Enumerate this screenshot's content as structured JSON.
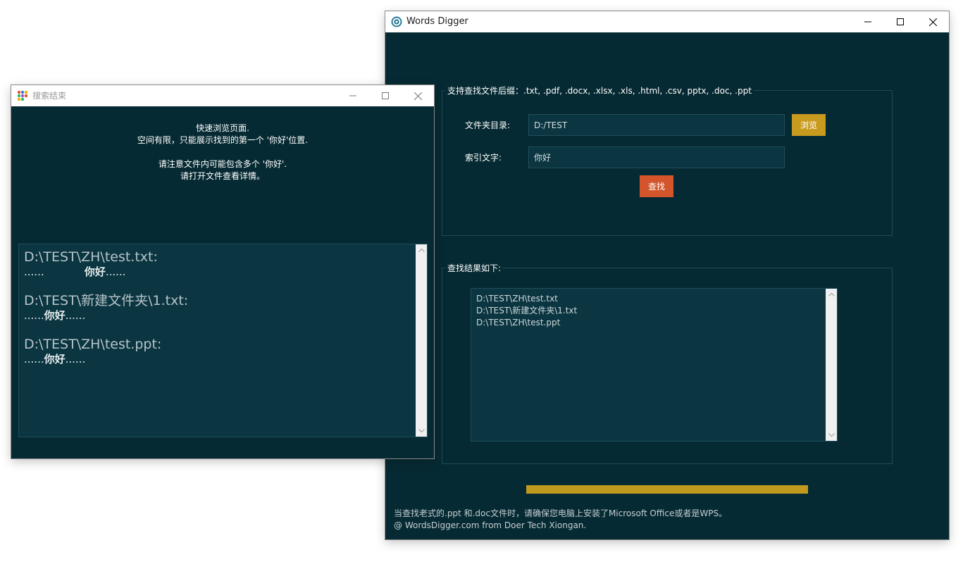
{
  "main_window": {
    "title": "Words Digger",
    "support_label": "支持查找文件后缀：.txt, .pdf, .docx, .xlsx, .xls, .html, .csv, pptx, .doc, .ppt",
    "folder_label": "文件夹目录:",
    "folder_value": "D:/TEST",
    "browse_label": "浏览",
    "keyword_label": "索引文字:",
    "keyword_value": "你好",
    "search_label": "查找",
    "results_group_label": "查找结果如下:",
    "results": [
      "D:\\TEST\\ZH\\test.txt",
      "D:\\TEST\\新建文件夹\\1.txt",
      "D:\\TEST\\ZH\\test.ppt"
    ],
    "progress": 1.0,
    "footer_line1": "当查找老式的.ppt 和.doc文件时，请确保您电脑上安装了Microsoft Office或者是WPS。",
    "footer_line2": "@ WordsDigger.com from Doer Tech Xiongan."
  },
  "results_window": {
    "title": "搜索结束",
    "info_line1": "快速浏览页面.",
    "info_line2": "空间有限，只能展示找到的第一个 '你好'位置.",
    "info_line3": "请注意文件内可能包含多个 '你好'.",
    "info_line4": "请打开文件查看详情。",
    "entries": [
      {
        "path": "D:\\TEST\\ZH\\test.txt:",
        "before": "......            ",
        "keyword": "你好",
        "after": "......"
      },
      {
        "path": "D:\\TEST\\新建文件夹\\1.txt:",
        "before": "......",
        "keyword": "你好",
        "after": "......"
      },
      {
        "path": "D:\\TEST\\ZH\\test.ppt:",
        "before": "......",
        "keyword": "你好",
        "after": "......"
      }
    ]
  },
  "colors": {
    "background": "#062a33",
    "field": "#0a3541",
    "browse_button": "#c89b1e",
    "search_button": "#d4552b",
    "progress_bar": "#c09a1f"
  },
  "icons": [
    "app-logo-icon",
    "colorful-dots-icon",
    "minimize-icon",
    "maximize-icon",
    "close-icon",
    "scroll-up-icon",
    "scroll-down-icon"
  ]
}
